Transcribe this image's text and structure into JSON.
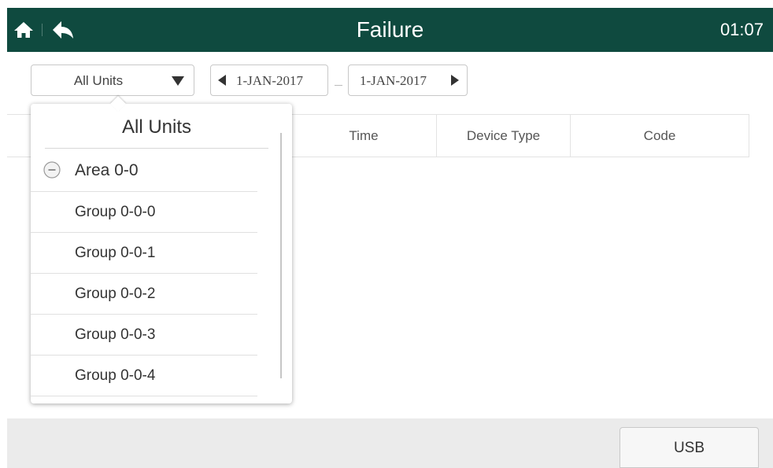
{
  "header": {
    "home_icon": "home-icon",
    "back_icon": "back-arrow-icon",
    "title": "Failure",
    "clock": "01:07"
  },
  "filters": {
    "unit_select": {
      "value": "All Units",
      "caret_icon": "triangle-down-icon"
    },
    "date_from": {
      "value": "1-JAN-2017",
      "arrow_icon": "triangle-left-icon"
    },
    "date_to": {
      "value": "1-JAN-2017",
      "arrow_icon": "triangle-right-icon"
    }
  },
  "table": {
    "columns": [
      "Time",
      "Device Type",
      "Code"
    ]
  },
  "dropdown": {
    "title": "All Units",
    "area": {
      "label": "Area 0-0",
      "icon": "collapse-minus-icon"
    },
    "groups": [
      "Group 0-0-0",
      "Group 0-0-1",
      "Group 0-0-2",
      "Group 0-0-3",
      "Group 0-0-4"
    ]
  },
  "footer": {
    "usb_label": "USB"
  },
  "colors": {
    "header_bg": "#0f4a3f",
    "footer_bg": "#ebebeb"
  }
}
